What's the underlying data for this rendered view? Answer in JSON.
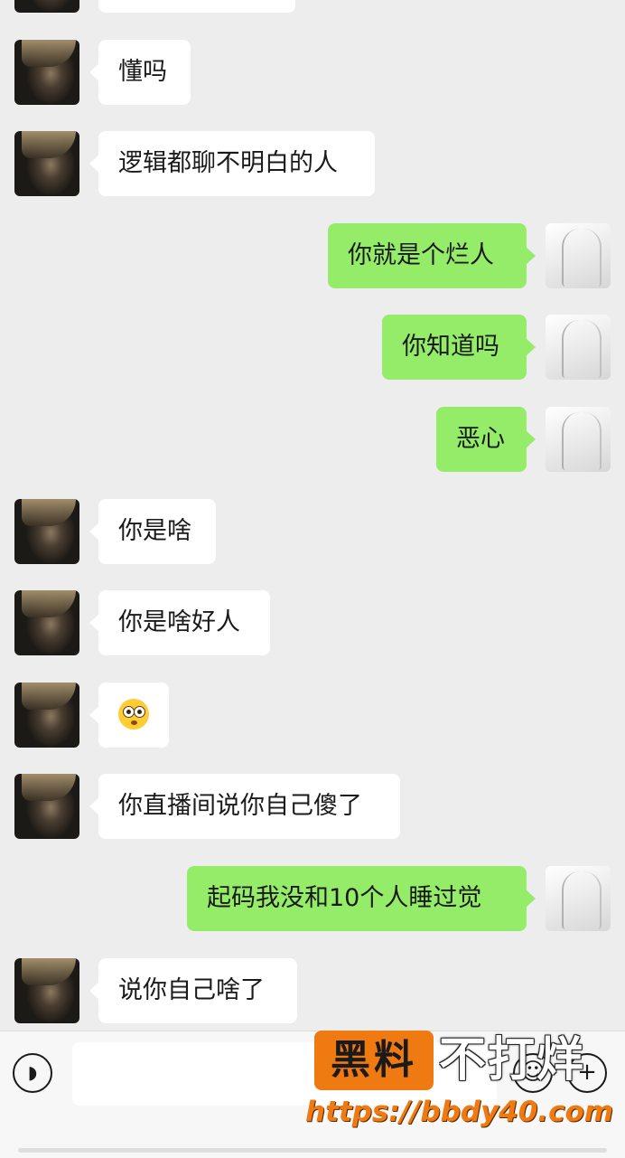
{
  "messages": [
    {
      "side": "left",
      "text": ""
    },
    {
      "side": "left",
      "text": "懂吗"
    },
    {
      "side": "left",
      "text": "逻辑都聊不明白的人"
    },
    {
      "side": "right",
      "text": "你就是个烂人"
    },
    {
      "side": "right",
      "text": "你知道吗"
    },
    {
      "side": "right",
      "text": "恶心"
    },
    {
      "side": "left",
      "text": "你是啥"
    },
    {
      "side": "left",
      "text": "你是啥好人"
    },
    {
      "side": "left",
      "emoji": "astonished-face-emoji"
    },
    {
      "side": "left",
      "text": "你直播间说你自己傻了"
    },
    {
      "side": "right",
      "text": "起码我没和10个人睡过觉"
    },
    {
      "side": "left",
      "text": "说你自己啥了"
    }
  ],
  "input_bar": {
    "voice_icon": "voice-icon",
    "input_value": "",
    "emoji_icon": "emoji-icon",
    "plus_icon": "plus-icon"
  },
  "watermark": {
    "box_text": "黑料",
    "text": "不打烊",
    "url": "https://bbdy40.com"
  },
  "colors": {
    "background": "#ededed",
    "sent_bubble": "#95ec69",
    "received_bubble": "#ffffff",
    "watermark_accent": "#f07a12"
  }
}
